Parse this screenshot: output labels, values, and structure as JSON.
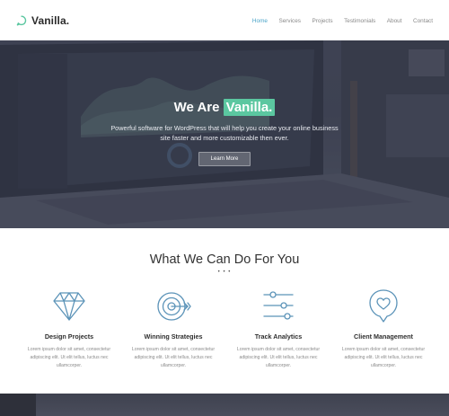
{
  "brand": {
    "name": "Vanilla.",
    "icon": "chat-bubble-icon",
    "accent_color": "#5bc7a0"
  },
  "nav": {
    "items": [
      {
        "label": "Home",
        "active": true
      },
      {
        "label": "Services",
        "active": false
      },
      {
        "label": "Projects",
        "active": false
      },
      {
        "label": "Testimonials",
        "active": false
      },
      {
        "label": "About",
        "active": false
      },
      {
        "label": "Contact",
        "active": false
      }
    ],
    "active_color": "#4aa4c8"
  },
  "hero": {
    "title_prefix": "We Are",
    "title_accent": "Vanilla.",
    "subtitle": "Powerful software for WordPress that will help you create your online business site faster and more customizable then ever.",
    "button_label": "Learn More"
  },
  "services": {
    "title": "What We Can Do For You",
    "dots": "• • •",
    "cards": [
      {
        "icon": "diamond-icon",
        "title": "Design Projects",
        "desc": "Lorem ipsum dolor sit amet, consectetur adipiscing elit. Ut elit tellus, luctus nec ullamcorper."
      },
      {
        "icon": "target-icon",
        "title": "Winning Strategies",
        "desc": "Lorem ipsum dolor sit amet, consectetur adipiscing elit. Ut elit tellus, luctus nec ullamcorper."
      },
      {
        "icon": "sliders-icon",
        "title": "Track Analytics",
        "desc": "Lorem ipsum dolor sit amet, consectetur adipiscing elit. Ut elit tellus, luctus nec ullamcorper."
      },
      {
        "icon": "heart-location-icon",
        "title": "Client Management",
        "desc": "Lorem ipsum dolor sit amet, consectetur adipiscing elit. Ut elit tellus, luctus nec ullamcorper."
      }
    ]
  }
}
